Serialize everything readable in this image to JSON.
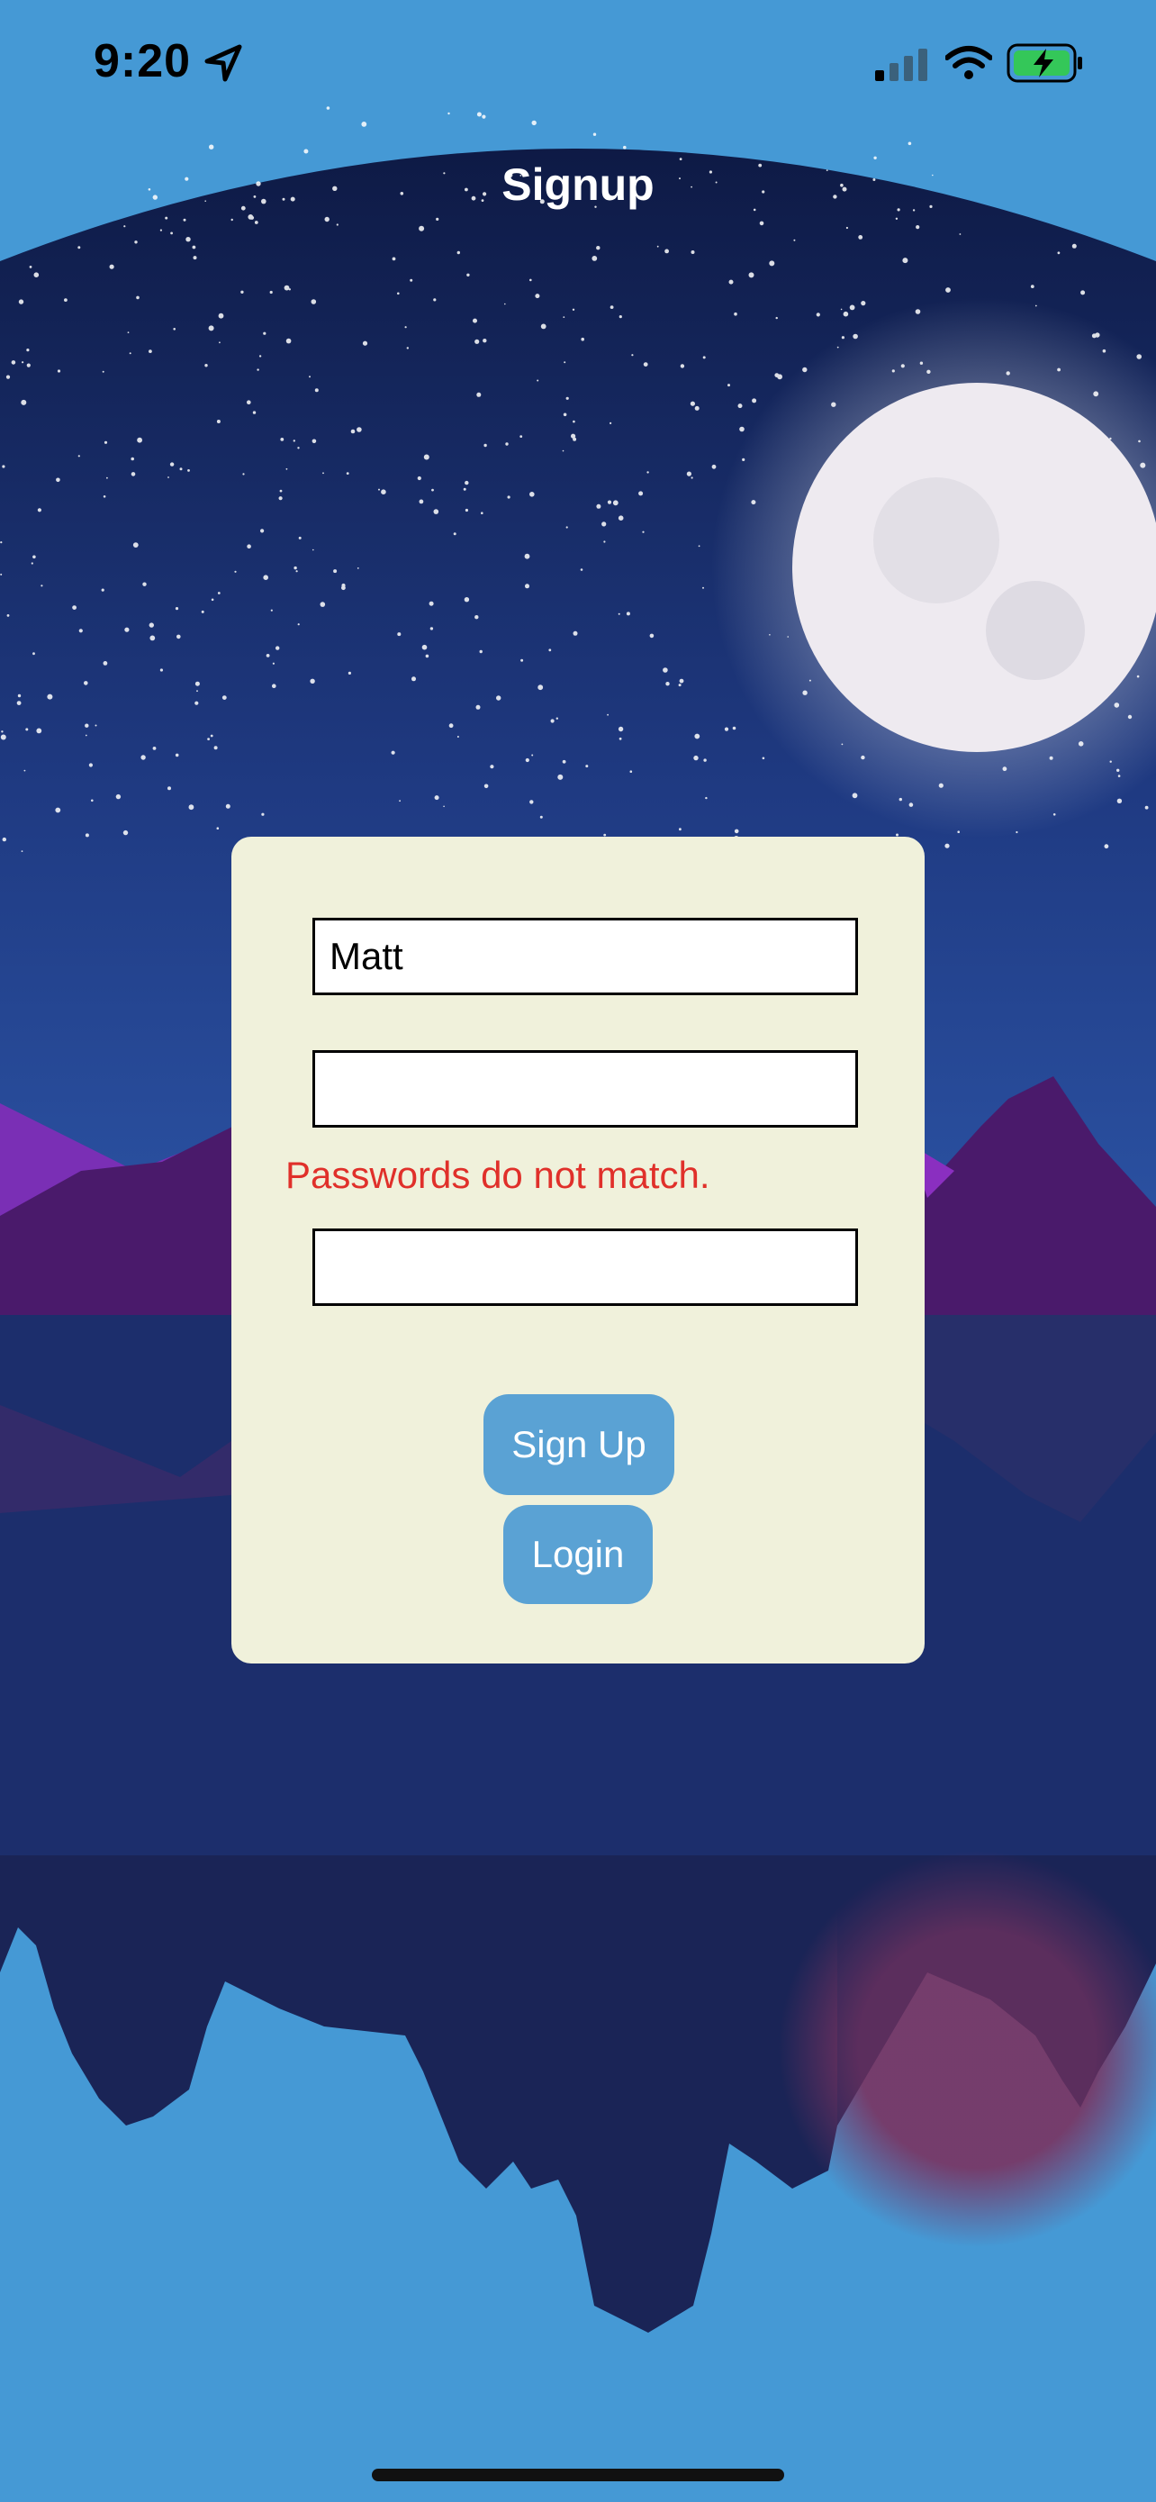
{
  "status_bar": {
    "time": "9:20",
    "icons": [
      "location-arrow-icon",
      "cellular-signal-icon",
      "wifi-icon",
      "battery-charging-icon"
    ]
  },
  "nav": {
    "title": "Signup"
  },
  "form": {
    "username_value": "Matt",
    "password_value": "",
    "confirm_value": "",
    "error": "Passwords do not match.",
    "signup_label": "Sign Up",
    "login_label": "Login"
  },
  "colors": {
    "background": "#4599d5",
    "card": "#f0f1db",
    "button": "#5aa2d4",
    "error": "#e0302a"
  }
}
